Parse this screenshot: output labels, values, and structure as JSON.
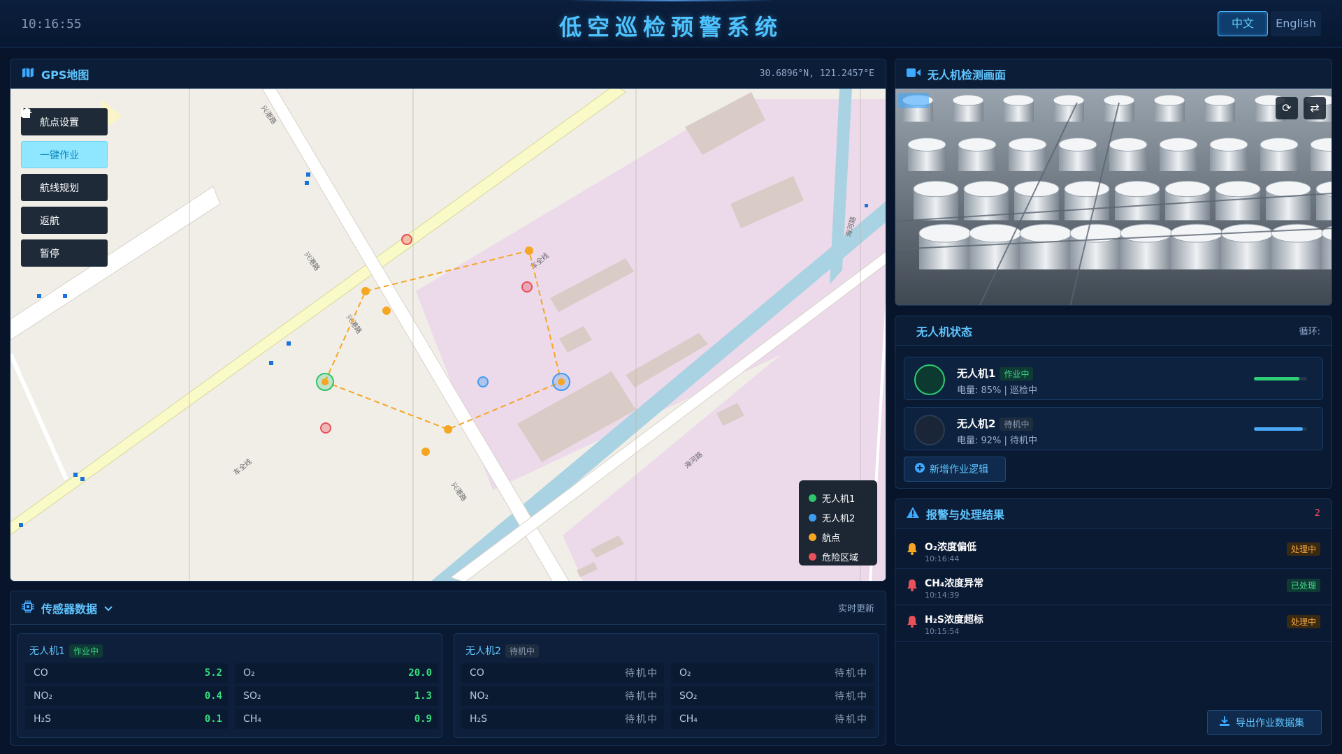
{
  "header": {
    "time": "10:16:55",
    "title": "低空巡检预警系统",
    "lang_zh": "中文",
    "lang_en": "English"
  },
  "map": {
    "title": "GPS地图",
    "coords": "30.6896°N, 121.2457°E",
    "controls": [
      {
        "label": "航点设置",
        "icon": "pin-icon"
      },
      {
        "label": "一键作业",
        "icon": "play-icon"
      },
      {
        "label": "航线规划",
        "icon": "route-icon"
      },
      {
        "label": "返航",
        "icon": "home-icon"
      },
      {
        "label": "暂停",
        "icon": "pause-icon"
      }
    ],
    "legend": [
      {
        "label": "无人机1",
        "color": "#31c46a"
      },
      {
        "label": "无人机2",
        "color": "#3f9cf0"
      },
      {
        "label": "航点",
        "color": "#f5a623"
      },
      {
        "label": "危险区域",
        "color": "#e8505b"
      }
    ],
    "road_labels": [
      "兴港路",
      "兴港路",
      "车全线",
      "车全线",
      "兴港路",
      "海河路",
      "海河路",
      "海河路",
      "兴港路"
    ]
  },
  "camera": {
    "title": "无人机检测画面"
  },
  "status": {
    "title": "无人机状态",
    "cycle_label": "循环:",
    "drones": [
      {
        "name": "无人机1",
        "state": "作业中",
        "info": "电量: 85% | 巡检中",
        "battery": 85,
        "color": "#2fcf77"
      },
      {
        "name": "无人机2",
        "state": "待机中",
        "info": "电量: 92% | 待机中",
        "battery": 92,
        "color": "#4aa8f5"
      }
    ],
    "add_label": "新增作业逻辑"
  },
  "alarm": {
    "title": "报警与处理结果",
    "count": "2",
    "items": [
      {
        "title": "O₂浓度偏低",
        "time": "10:16:44",
        "status": "处理中",
        "icon_color": "#f5a623"
      },
      {
        "title": "CH₄浓度异常",
        "time": "10:14:39",
        "status": "已处理",
        "icon_color": "#e8505b"
      },
      {
        "title": "H₂S浓度超标",
        "time": "10:15:54",
        "status": "处理中",
        "icon_color": "#e8505b"
      }
    ],
    "export_label": "导出作业数据集"
  },
  "sensor": {
    "title": "传感器数据",
    "realtime": "实时更新",
    "groups": [
      {
        "name": "无人机1",
        "state": "作业中",
        "values": [
          {
            "k": "CO",
            "v": "5.2"
          },
          {
            "k": "O₂",
            "v": "20.0"
          },
          {
            "k": "NO₂",
            "v": "0.4"
          },
          {
            "k": "SO₂",
            "v": "1.3"
          },
          {
            "k": "H₂S",
            "v": "0.1"
          },
          {
            "k": "CH₄",
            "v": "0.9"
          }
        ]
      },
      {
        "name": "无人机2",
        "state": "待机中",
        "values": [
          {
            "k": "CO",
            "v": "待机中"
          },
          {
            "k": "O₂",
            "v": "待机中"
          },
          {
            "k": "NO₂",
            "v": "待机中"
          },
          {
            "k": "SO₂",
            "v": "待机中"
          },
          {
            "k": "H₂S",
            "v": "待机中"
          },
          {
            "k": "CH₄",
            "v": "待机中"
          }
        ]
      }
    ]
  }
}
